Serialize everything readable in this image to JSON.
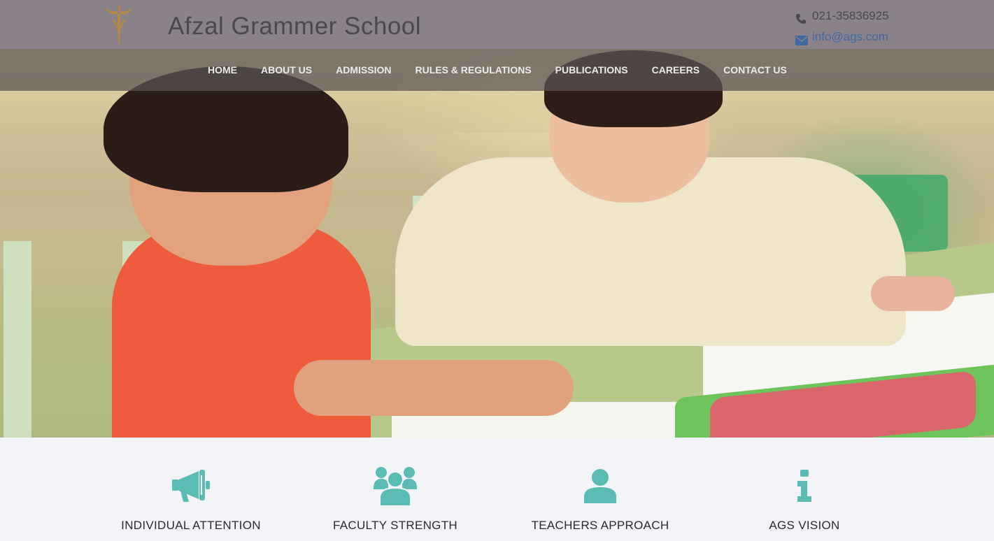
{
  "header": {
    "school_name": "Afzal Grammer School",
    "phone": "021-35836925",
    "email": "info@ags.com",
    "logo_icon": "school-crest-icon",
    "phone_icon": "phone-icon",
    "email_icon": "envelope-icon"
  },
  "nav": {
    "items": [
      {
        "label": "HOME"
      },
      {
        "label": "ABOUT US"
      },
      {
        "label": "ADMISSION"
      },
      {
        "label": "RULES & REGULATIONS"
      },
      {
        "label": "PUBLICATIONS"
      },
      {
        "label": "CAREERS"
      },
      {
        "label": "CONTACT US"
      }
    ]
  },
  "features": {
    "items": [
      {
        "label": "INDIVIDUAL ATTENTION",
        "icon": "megaphone-icon"
      },
      {
        "label": "FACULTY STRENGTH",
        "icon": "group-icon"
      },
      {
        "label": "TEACHERS APPROACH",
        "icon": "user-icon"
      },
      {
        "label": "AGS VISION",
        "icon": "info-icon"
      }
    ]
  },
  "colors": {
    "header_bg": "#8a8189",
    "nav_bg": "#5c5456",
    "accent_teal": "#5bbcb4",
    "link_blue": "#3f6aa0"
  }
}
